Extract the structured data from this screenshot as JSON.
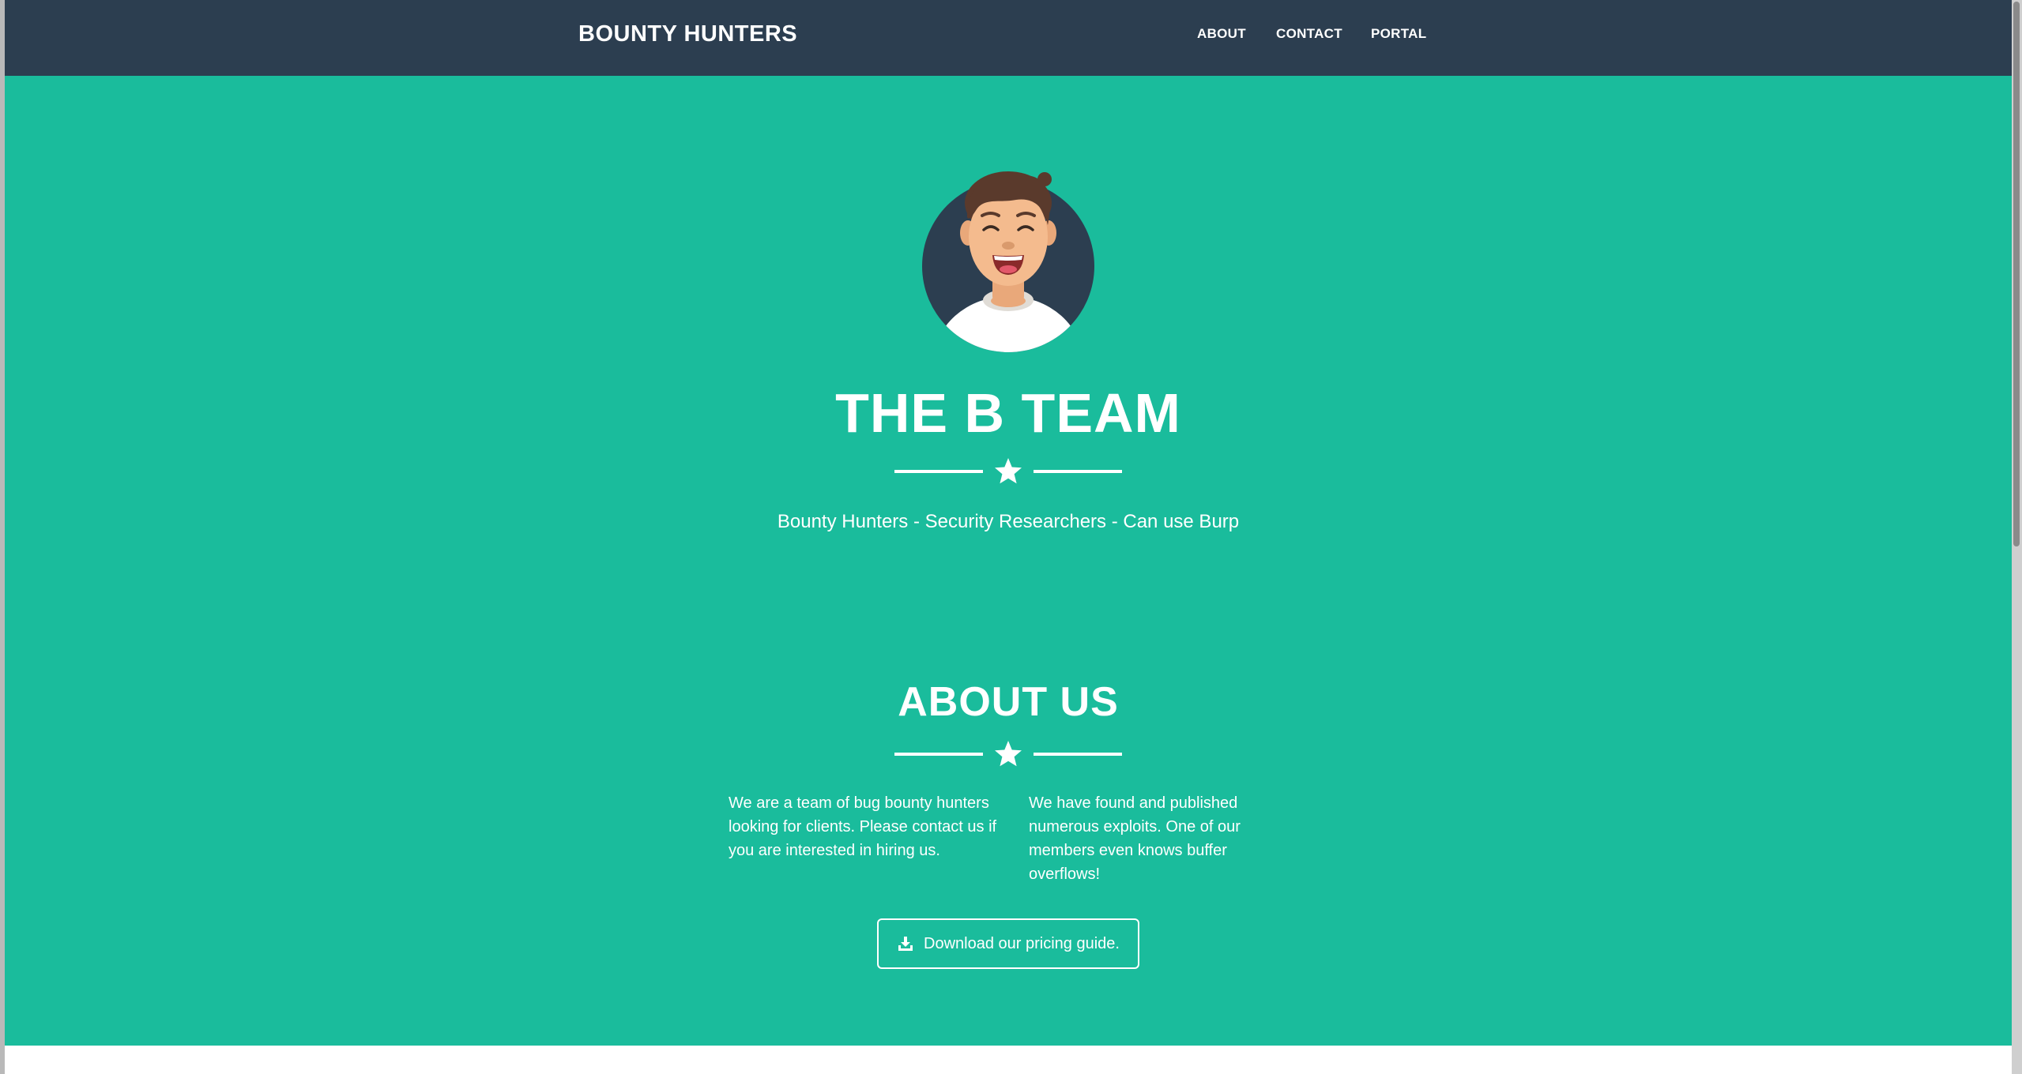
{
  "navbar": {
    "brand": "BOUNTY HUNTERS",
    "links": [
      {
        "label": "ABOUT"
      },
      {
        "label": "CONTACT"
      },
      {
        "label": "PORTAL"
      }
    ]
  },
  "hero": {
    "title": "THE B TEAM",
    "subtitle": "Bounty Hunters - Security Researchers - Can use Burp",
    "avatar_icon": "avatar-icon",
    "divider_icon": "star-icon"
  },
  "about": {
    "title": "ABOUT US",
    "col_left": "We are a team of bug bounty hunters looking for clients. Please contact us if you are interested in hiring us.",
    "col_right": "We have found and published numerous exploits. One of our members even knows buffer overflows!",
    "button_label": "Download our pricing guide.",
    "button_icon": "download-icon"
  },
  "colors": {
    "navbar": "#2c3e50",
    "primary": "#1abc9c",
    "text": "#ffffff"
  }
}
